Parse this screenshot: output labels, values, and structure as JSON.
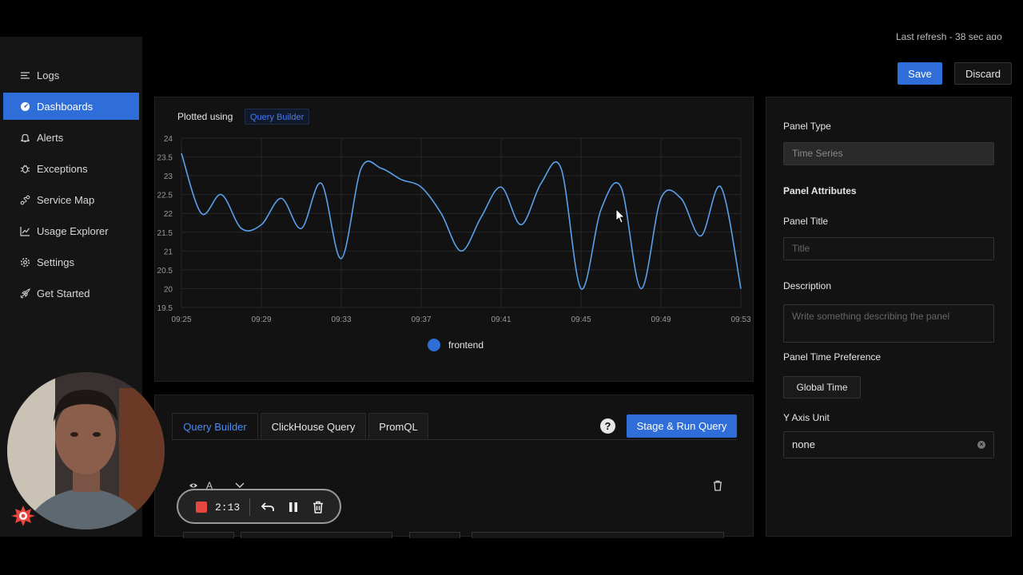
{
  "sidebar": {
    "items": [
      {
        "label": "Logs",
        "icon": "list-icon",
        "active": false
      },
      {
        "label": "Dashboards",
        "icon": "dashboard-icon",
        "active": true
      },
      {
        "label": "Alerts",
        "icon": "bell-icon",
        "active": false
      },
      {
        "label": "Exceptions",
        "icon": "bug-icon",
        "active": false
      },
      {
        "label": "Service Map",
        "icon": "route-icon",
        "active": false
      },
      {
        "label": "Usage Explorer",
        "icon": "line-chart-icon",
        "active": false
      },
      {
        "label": "Settings",
        "icon": "gear-icon",
        "active": false
      },
      {
        "label": "Get Started",
        "icon": "rocket-icon",
        "active": false
      }
    ]
  },
  "header": {
    "refresh_text": "Last refresh - 38 sec ago",
    "save_label": "Save",
    "discard_label": "Discard"
  },
  "chart_panel": {
    "plotted_label": "Plotted using",
    "tag": "Query Builder"
  },
  "chart_data": {
    "type": "line",
    "x": [
      "09:25",
      "09:26",
      "09:27",
      "09:28",
      "09:29",
      "09:30",
      "09:31",
      "09:32",
      "09:33",
      "09:34",
      "09:35",
      "09:36",
      "09:37",
      "09:38",
      "09:39",
      "09:40",
      "09:41",
      "09:42",
      "09:43",
      "09:44",
      "09:45",
      "09:46",
      "09:47",
      "09:48",
      "09:49",
      "09:50",
      "09:51",
      "09:52",
      "09:53"
    ],
    "x_ticks": [
      "09:25",
      "09:29",
      "09:33",
      "09:37",
      "09:41",
      "09:45",
      "09:49",
      "09:53"
    ],
    "y_ticks": [
      "24",
      "23.5",
      "23",
      "22.5",
      "22",
      "21.5",
      "21",
      "20.5",
      "20",
      "19.5"
    ],
    "ylim": [
      19.5,
      24
    ],
    "series": [
      {
        "name": "frontend",
        "color": "#5aa0ea",
        "values": [
          23.6,
          22.0,
          22.5,
          21.6,
          21.7,
          22.4,
          21.6,
          22.8,
          20.8,
          23.2,
          23.2,
          22.9,
          22.7,
          22.0,
          21.0,
          21.9,
          22.7,
          21.7,
          22.8,
          23.2,
          20.0,
          22.1,
          22.7,
          20.0,
          22.4,
          22.4,
          21.4,
          22.7,
          20.0
        ]
      }
    ],
    "legend": "bottom",
    "grid": true
  },
  "query_panel": {
    "tabs": [
      {
        "label": "Query Builder",
        "active": true
      },
      {
        "label": "ClickHouse Query",
        "active": false
      },
      {
        "label": "PromQL",
        "active": false
      }
    ],
    "help": "?",
    "run_label": "Stage & Run Query",
    "query_name": "A"
  },
  "side_panel": {
    "panel_type_label": "Panel Type",
    "panel_type_value": "Time Series",
    "attributes_heading": "Panel Attributes",
    "title_label": "Panel Title",
    "title_placeholder": "Title",
    "description_label": "Description",
    "description_placeholder": "Write something describing the  panel",
    "time_pref_label": "Panel Time Preference",
    "time_pref_value": "Global Time",
    "y_unit_label": "Y Axis Unit",
    "y_unit_value": "none"
  },
  "recorder": {
    "time": "2:13"
  }
}
